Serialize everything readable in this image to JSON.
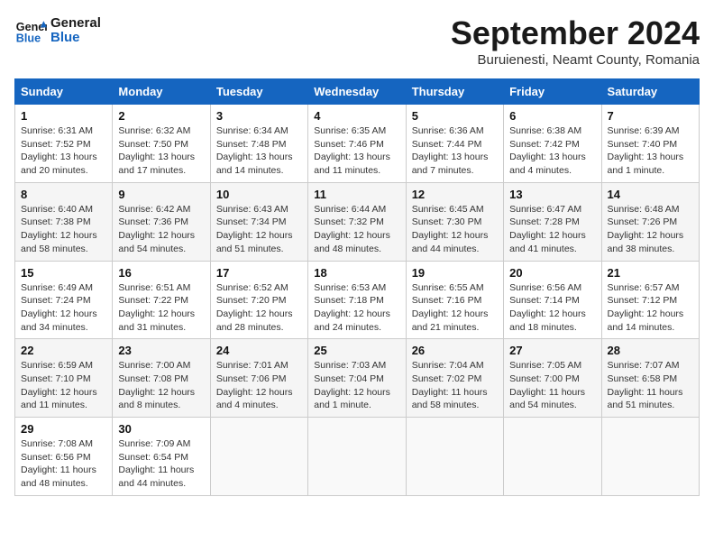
{
  "header": {
    "logo_general": "General",
    "logo_blue": "Blue",
    "month_title": "September 2024",
    "subtitle": "Buruienesti, Neamt County, Romania"
  },
  "weekdays": [
    "Sunday",
    "Monday",
    "Tuesday",
    "Wednesday",
    "Thursday",
    "Friday",
    "Saturday"
  ],
  "weeks": [
    [
      {
        "day": "1",
        "sunrise": "Sunrise: 6:31 AM",
        "sunset": "Sunset: 7:52 PM",
        "daylight": "Daylight: 13 hours and 20 minutes."
      },
      {
        "day": "2",
        "sunrise": "Sunrise: 6:32 AM",
        "sunset": "Sunset: 7:50 PM",
        "daylight": "Daylight: 13 hours and 17 minutes."
      },
      {
        "day": "3",
        "sunrise": "Sunrise: 6:34 AM",
        "sunset": "Sunset: 7:48 PM",
        "daylight": "Daylight: 13 hours and 14 minutes."
      },
      {
        "day": "4",
        "sunrise": "Sunrise: 6:35 AM",
        "sunset": "Sunset: 7:46 PM",
        "daylight": "Daylight: 13 hours and 11 minutes."
      },
      {
        "day": "5",
        "sunrise": "Sunrise: 6:36 AM",
        "sunset": "Sunset: 7:44 PM",
        "daylight": "Daylight: 13 hours and 7 minutes."
      },
      {
        "day": "6",
        "sunrise": "Sunrise: 6:38 AM",
        "sunset": "Sunset: 7:42 PM",
        "daylight": "Daylight: 13 hours and 4 minutes."
      },
      {
        "day": "7",
        "sunrise": "Sunrise: 6:39 AM",
        "sunset": "Sunset: 7:40 PM",
        "daylight": "Daylight: 13 hours and 1 minute."
      }
    ],
    [
      {
        "day": "8",
        "sunrise": "Sunrise: 6:40 AM",
        "sunset": "Sunset: 7:38 PM",
        "daylight": "Daylight: 12 hours and 58 minutes."
      },
      {
        "day": "9",
        "sunrise": "Sunrise: 6:42 AM",
        "sunset": "Sunset: 7:36 PM",
        "daylight": "Daylight: 12 hours and 54 minutes."
      },
      {
        "day": "10",
        "sunrise": "Sunrise: 6:43 AM",
        "sunset": "Sunset: 7:34 PM",
        "daylight": "Daylight: 12 hours and 51 minutes."
      },
      {
        "day": "11",
        "sunrise": "Sunrise: 6:44 AM",
        "sunset": "Sunset: 7:32 PM",
        "daylight": "Daylight: 12 hours and 48 minutes."
      },
      {
        "day": "12",
        "sunrise": "Sunrise: 6:45 AM",
        "sunset": "Sunset: 7:30 PM",
        "daylight": "Daylight: 12 hours and 44 minutes."
      },
      {
        "day": "13",
        "sunrise": "Sunrise: 6:47 AM",
        "sunset": "Sunset: 7:28 PM",
        "daylight": "Daylight: 12 hours and 41 minutes."
      },
      {
        "day": "14",
        "sunrise": "Sunrise: 6:48 AM",
        "sunset": "Sunset: 7:26 PM",
        "daylight": "Daylight: 12 hours and 38 minutes."
      }
    ],
    [
      {
        "day": "15",
        "sunrise": "Sunrise: 6:49 AM",
        "sunset": "Sunset: 7:24 PM",
        "daylight": "Daylight: 12 hours and 34 minutes."
      },
      {
        "day": "16",
        "sunrise": "Sunrise: 6:51 AM",
        "sunset": "Sunset: 7:22 PM",
        "daylight": "Daylight: 12 hours and 31 minutes."
      },
      {
        "day": "17",
        "sunrise": "Sunrise: 6:52 AM",
        "sunset": "Sunset: 7:20 PM",
        "daylight": "Daylight: 12 hours and 28 minutes."
      },
      {
        "day": "18",
        "sunrise": "Sunrise: 6:53 AM",
        "sunset": "Sunset: 7:18 PM",
        "daylight": "Daylight: 12 hours and 24 minutes."
      },
      {
        "day": "19",
        "sunrise": "Sunrise: 6:55 AM",
        "sunset": "Sunset: 7:16 PM",
        "daylight": "Daylight: 12 hours and 21 minutes."
      },
      {
        "day": "20",
        "sunrise": "Sunrise: 6:56 AM",
        "sunset": "Sunset: 7:14 PM",
        "daylight": "Daylight: 12 hours and 18 minutes."
      },
      {
        "day": "21",
        "sunrise": "Sunrise: 6:57 AM",
        "sunset": "Sunset: 7:12 PM",
        "daylight": "Daylight: 12 hours and 14 minutes."
      }
    ],
    [
      {
        "day": "22",
        "sunrise": "Sunrise: 6:59 AM",
        "sunset": "Sunset: 7:10 PM",
        "daylight": "Daylight: 12 hours and 11 minutes."
      },
      {
        "day": "23",
        "sunrise": "Sunrise: 7:00 AM",
        "sunset": "Sunset: 7:08 PM",
        "daylight": "Daylight: 12 hours and 8 minutes."
      },
      {
        "day": "24",
        "sunrise": "Sunrise: 7:01 AM",
        "sunset": "Sunset: 7:06 PM",
        "daylight": "Daylight: 12 hours and 4 minutes."
      },
      {
        "day": "25",
        "sunrise": "Sunrise: 7:03 AM",
        "sunset": "Sunset: 7:04 PM",
        "daylight": "Daylight: 12 hours and 1 minute."
      },
      {
        "day": "26",
        "sunrise": "Sunrise: 7:04 AM",
        "sunset": "Sunset: 7:02 PM",
        "daylight": "Daylight: 11 hours and 58 minutes."
      },
      {
        "day": "27",
        "sunrise": "Sunrise: 7:05 AM",
        "sunset": "Sunset: 7:00 PM",
        "daylight": "Daylight: 11 hours and 54 minutes."
      },
      {
        "day": "28",
        "sunrise": "Sunrise: 7:07 AM",
        "sunset": "Sunset: 6:58 PM",
        "daylight": "Daylight: 11 hours and 51 minutes."
      }
    ],
    [
      {
        "day": "29",
        "sunrise": "Sunrise: 7:08 AM",
        "sunset": "Sunset: 6:56 PM",
        "daylight": "Daylight: 11 hours and 48 minutes."
      },
      {
        "day": "30",
        "sunrise": "Sunrise: 7:09 AM",
        "sunset": "Sunset: 6:54 PM",
        "daylight": "Daylight: 11 hours and 44 minutes."
      },
      null,
      null,
      null,
      null,
      null
    ]
  ]
}
